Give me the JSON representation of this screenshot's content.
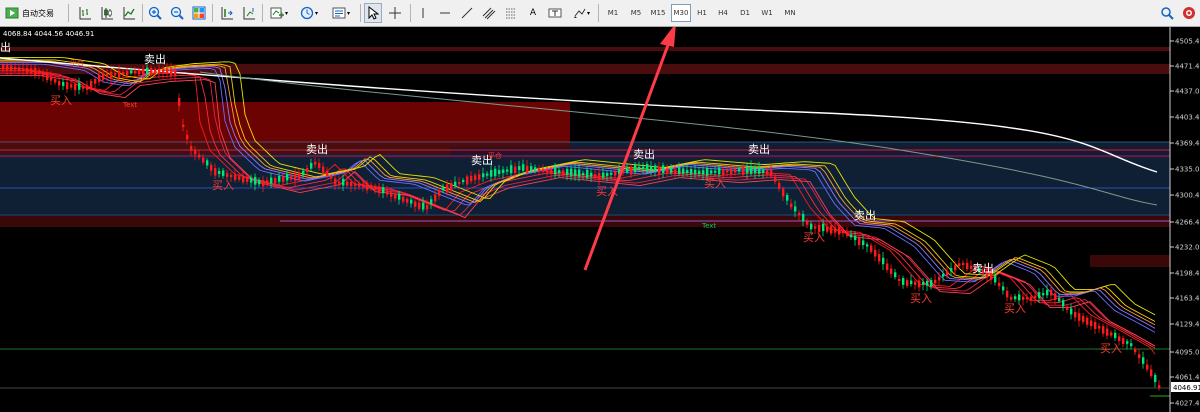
{
  "toolbar": {
    "auto_trading_label": "自动交易",
    "text_tool_label": "A",
    "timeframes": [
      "M1",
      "M5",
      "M15",
      "M30",
      "H1",
      "H4",
      "D1",
      "W1",
      "MN"
    ],
    "active_timeframe": "M30"
  },
  "chart": {
    "ohlc_header": "4068.84 4044.56 4046.91",
    "current_price_label": "4046.91",
    "price_labels": [
      "4505.40",
      "4471.40",
      "4437.00",
      "4403.40",
      "4369.40",
      "4335.00",
      "4300.40",
      "4266.40",
      "4232.00",
      "4198.40",
      "4163.40",
      "4129.40",
      "4095.00",
      "4061.40",
      "4027.40"
    ],
    "signals": [
      {
        "text": "出",
        "type": "sell"
      },
      {
        "text": "卖出",
        "type": "sell"
      },
      {
        "text": "买入",
        "type": "buy"
      },
      {
        "text": "卖出",
        "type": "sell"
      },
      {
        "text": "买入",
        "type": "buy"
      },
      {
        "text": "卖出",
        "type": "sell"
      },
      {
        "text": "买入",
        "type": "buy"
      },
      {
        "text": "卖出",
        "type": "sell"
      },
      {
        "text": "卖出",
        "type": "sell"
      },
      {
        "text": "买入",
        "type": "buy"
      },
      {
        "text": "卖出",
        "type": "sell"
      },
      {
        "text": "买入",
        "type": "buy"
      },
      {
        "text": "卖出",
        "type": "sell"
      },
      {
        "text": "买入",
        "type": "buy"
      },
      {
        "text": "买入",
        "type": "buy"
      },
      {
        "text": "买入",
        "type": "buy"
      }
    ],
    "small_labels": [
      "平仓",
      "Text",
      "平仓",
      "Text"
    ],
    "colors": {
      "bull_candle": "#00e676",
      "bear_candle": "#ff1a1a",
      "sell_label": "#ffffff",
      "buy_label": "#ff3b30",
      "arrow": "#ff3b48"
    }
  }
}
